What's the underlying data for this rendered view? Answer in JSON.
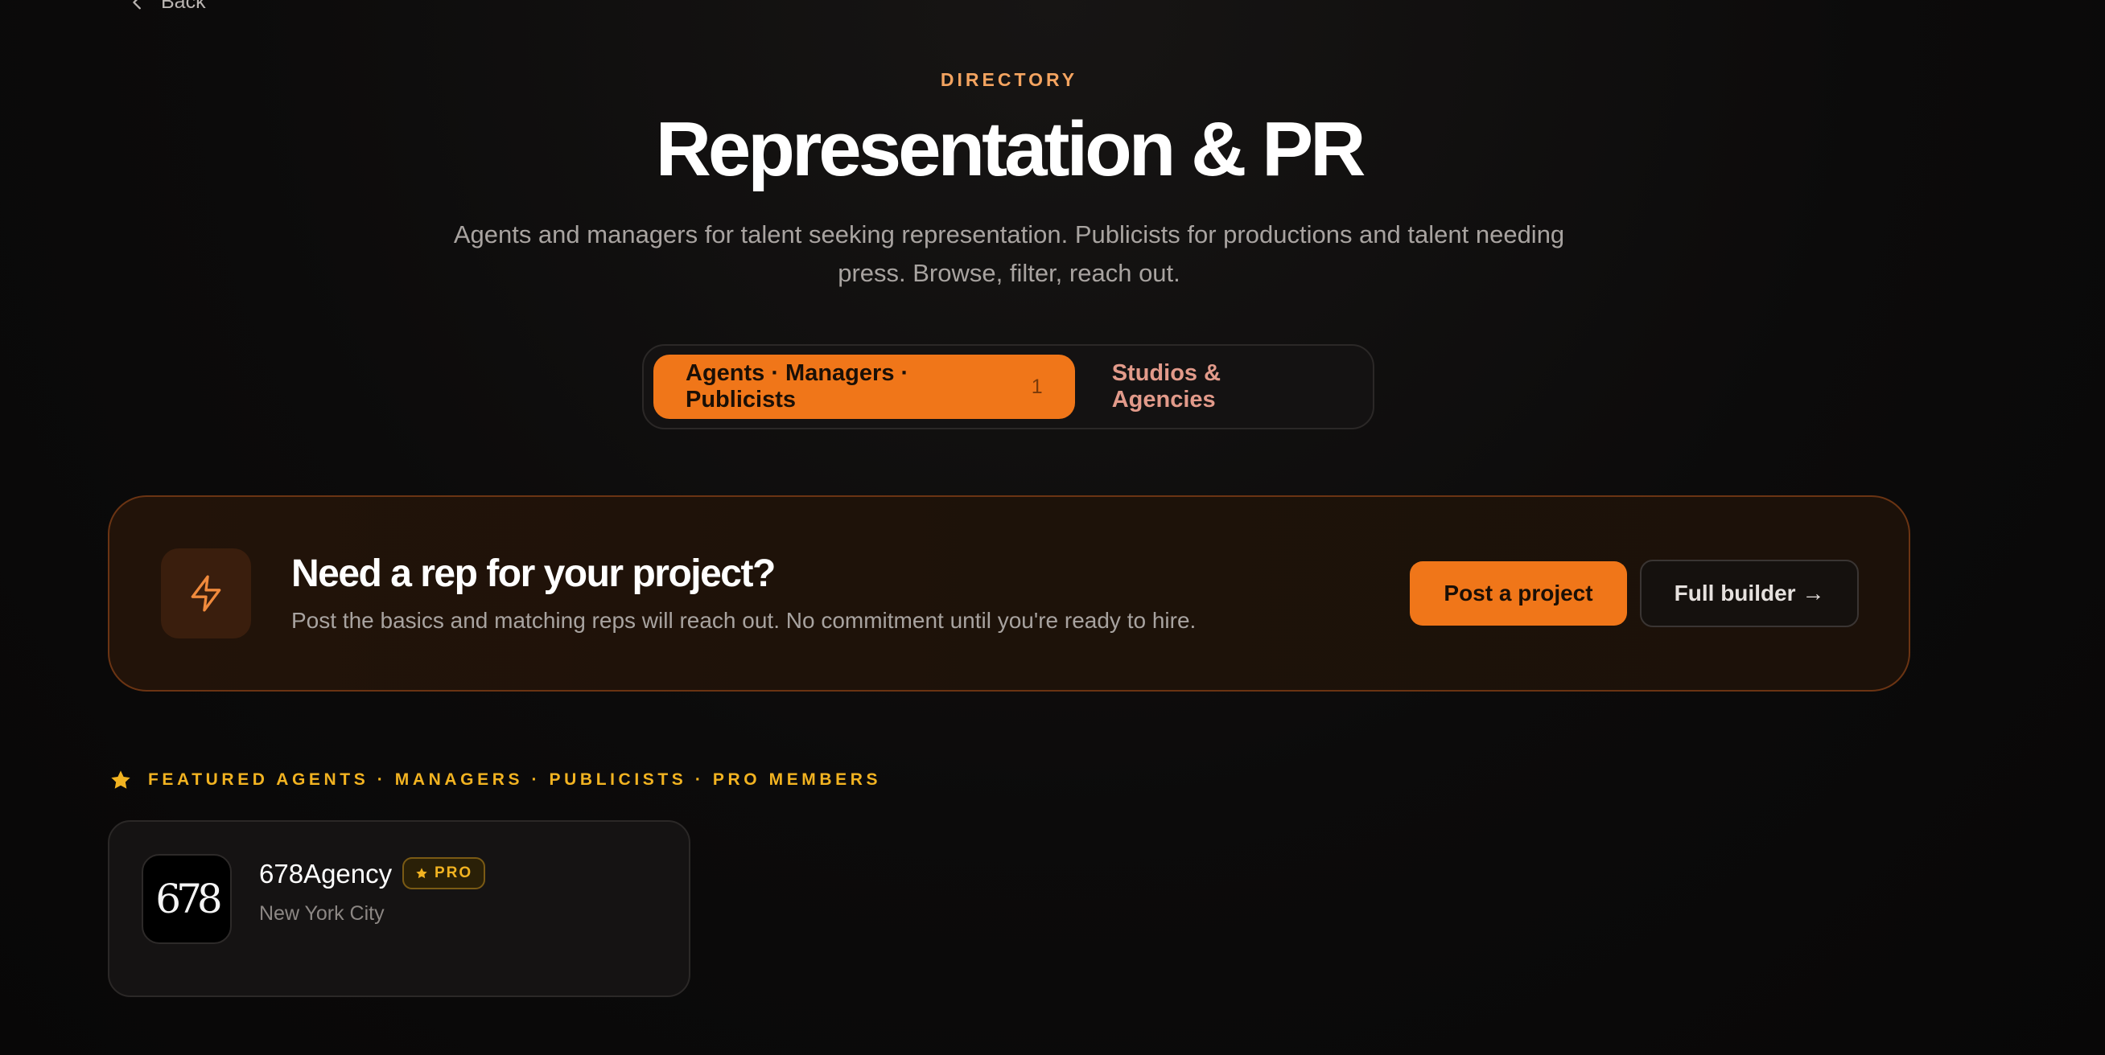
{
  "nav": {
    "back_label": "Back"
  },
  "hero": {
    "eyebrow": "DIRECTORY",
    "title": "Representation & PR",
    "subtitle": "Agents and managers for talent seeking representation. Publicists for productions and talent needing press. Browse, filter, reach out."
  },
  "tabs": [
    {
      "label": "Agents · Managers · Publicists",
      "count": "1",
      "active": true
    },
    {
      "label": "Studios & Agencies",
      "active": false
    }
  ],
  "cta": {
    "icon": "lightning-icon",
    "title": "Need a rep for your project?",
    "text": "Post the basics and matching reps will reach out. No commitment until you're ready to hire.",
    "primary_label": "Post a project",
    "secondary_label": "Full builder →"
  },
  "featured": {
    "icon": "star-icon",
    "heading": "FEATURED AGENTS · MANAGERS · PUBLICISTS · PRO MEMBERS",
    "items": [
      {
        "logo_text": "678",
        "name": "678Agency",
        "badge": "PRO",
        "location": "New York City"
      }
    ]
  },
  "colors": {
    "accent": "#f07619",
    "eyebrow": "#f4a460",
    "gold": "#f2b321",
    "background": "#0b0a0a"
  }
}
